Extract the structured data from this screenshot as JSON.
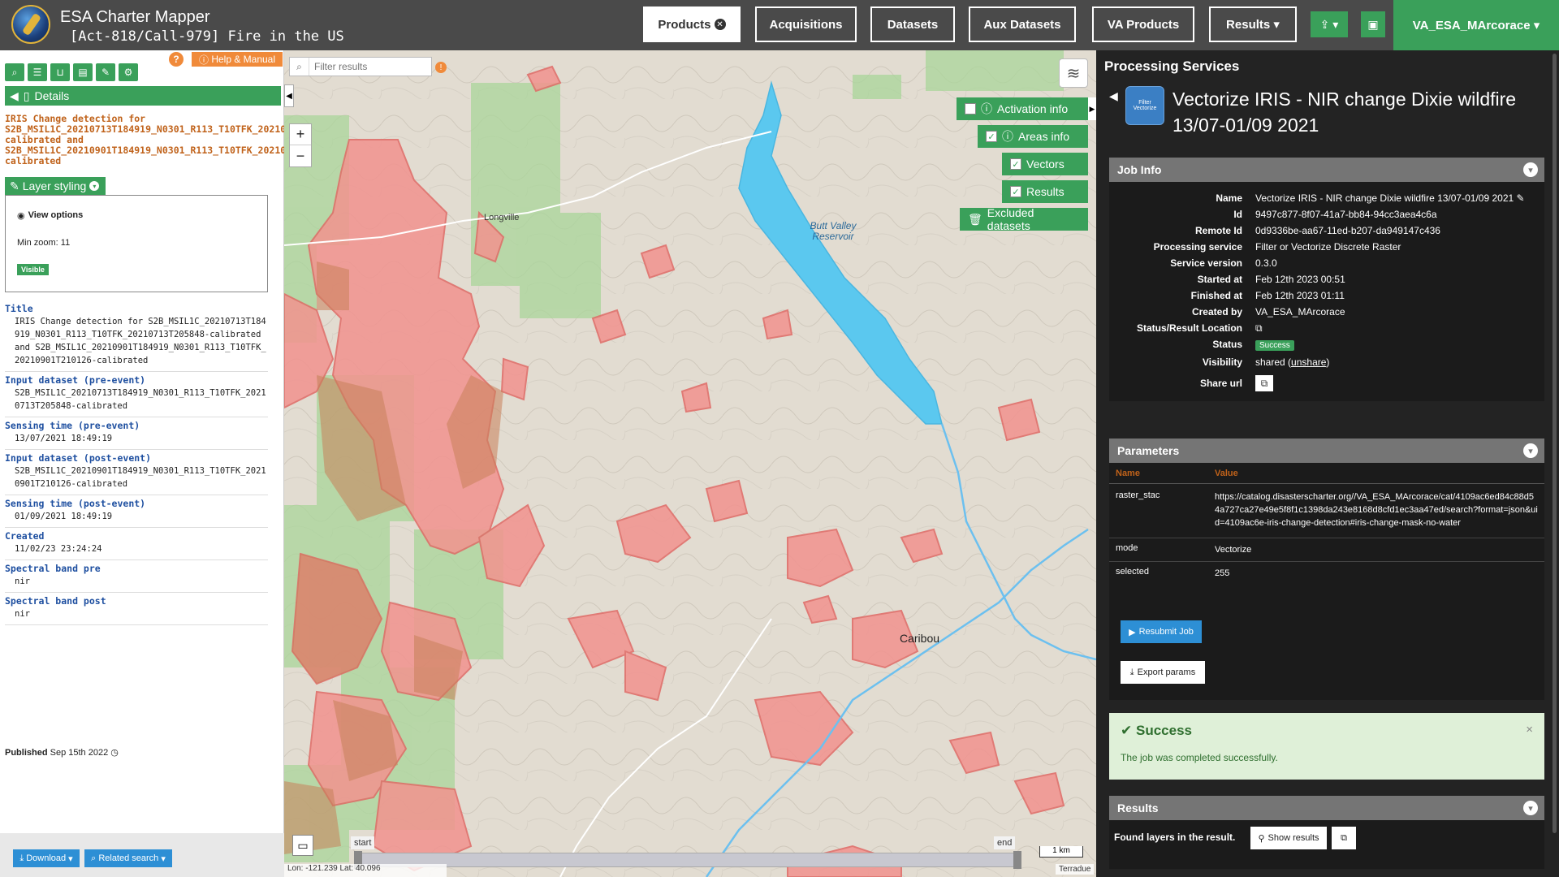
{
  "header": {
    "app_title": "ESA Charter Mapper",
    "activation_title": "[Act-818/Call-979] Fire in the US",
    "nav": [
      "Products",
      "Acquisitions",
      "Datasets",
      "Aux Datasets",
      "VA Products",
      "Results ▾"
    ],
    "user": "VA_ESA_MArcorace ▾"
  },
  "left": {
    "help_label": "Help & Manual",
    "details_label": "Details",
    "product_title": "IRIS Change detection for S2B_MSIL1C_20210713T184919_N0301_R113_T10TFK_20210713T205848-calibrated and S2B_MSIL1C_20210901T184919_N0301_R113_T10TFK_20210901T210126-calibrated",
    "layer_styling": "Layer styling",
    "view_options": "View options",
    "min_zoom": "Min zoom: 11",
    "visible": "Visible",
    "meta": [
      {
        "label": "Title",
        "value": "IRIS Change detection for S2B_MSIL1C_20210713T184919_N0301_R113_T10TFK_20210713T205848-calibrated and S2B_MSIL1C_20210901T184919_N0301_R113_T10TFK_20210901T210126-calibrated"
      },
      {
        "label": "Input dataset (pre-event)",
        "value": "S2B_MSIL1C_20210713T184919_N0301_R113_T10TFK_20210713T205848-calibrated"
      },
      {
        "label": "Sensing time (pre-event)",
        "value": "13/07/2021 18:49:19"
      },
      {
        "label": "Input dataset (post-event)",
        "value": "S2B_MSIL1C_20210901T184919_N0301_R113_T10TFK_20210901T210126-calibrated"
      },
      {
        "label": "Sensing time (post-event)",
        "value": "01/09/2021 18:49:19"
      },
      {
        "label": "Created",
        "value": "11/02/23 23:24:24"
      },
      {
        "label": "Spectral band pre",
        "value": "nir"
      },
      {
        "label": "Spectral band post",
        "value": "nir"
      }
    ],
    "published_label": "Published",
    "published_date": "Sep 15th 2022",
    "download": "Download",
    "related_search": "Related search"
  },
  "map": {
    "filter_placeholder": "Filter results",
    "activation_info": "Activation info",
    "areas_info": "Areas info",
    "vectors": "Vectors",
    "results": "Results",
    "excluded": "Excluded datasets",
    "place_longville": "Longville",
    "place_reservoir": "Butt Valley Reservoir",
    "place_caribou": "Caribou",
    "timeline_start": "start",
    "timeline_end": "end",
    "scale": "1 km",
    "coords": "Lon: -121.239 Lat: 40.096",
    "attribution": "Terradue"
  },
  "right": {
    "section_title": "Processing Services",
    "service_thumb": "Filter Vectorize",
    "job_title": "Vectorize IRIS - NIR change Dixie wildfire 13/07-01/09 2021",
    "job_info_label": "Job Info",
    "job_info": [
      {
        "k": "Name",
        "v": "Vectorize IRIS - NIR change Dixie wildfire 13/07-01/09 2021 ✎"
      },
      {
        "k": "Id",
        "v": "9497c877-8f07-41a7-bb84-94cc3aea4c6a"
      },
      {
        "k": "Remote Id",
        "v": "0d9336be-aa67-11ed-b207-da949147c436"
      },
      {
        "k": "Processing service",
        "v": "Filter or Vectorize Discrete Raster"
      },
      {
        "k": "Service version",
        "v": "0.3.0"
      },
      {
        "k": "Started at",
        "v": "Feb 12th 2023 00:51"
      },
      {
        "k": "Finished at",
        "v": "Feb 12th 2023 01:11"
      },
      {
        "k": "Created by",
        "v": "VA_ESA_MArcorace"
      }
    ],
    "status_location_label": "Status/Result Location",
    "status_label": "Status",
    "status_value": "Success",
    "visibility_label": "Visibility",
    "visibility_value": "shared",
    "unshare": "unshare",
    "share_url_label": "Share url",
    "parameters_label": "Parameters",
    "param_name_header": "Name",
    "param_value_header": "Value",
    "params": [
      {
        "k": "raster_stac",
        "v": "https://catalog.disasterscharter.org//VA_ESA_MArcorace/cat/4109ac6ed84c88d54a727ca27e49e5f8f1c1398da243e8168d8cfd1ec3aa47ed/search?format=json&uid=4109ac6e-iris-change-detection#iris-change-mask-no-water"
      },
      {
        "k": "mode",
        "v": "Vectorize"
      },
      {
        "k": "selected",
        "v": "255"
      }
    ],
    "resubmit": "Resubmit Job",
    "export": "Export params",
    "success_title": "Success",
    "success_msg": "The job was completed successfully.",
    "results_label": "Results",
    "found_layers": "Found layers in the result.",
    "show_results": "Show results"
  }
}
